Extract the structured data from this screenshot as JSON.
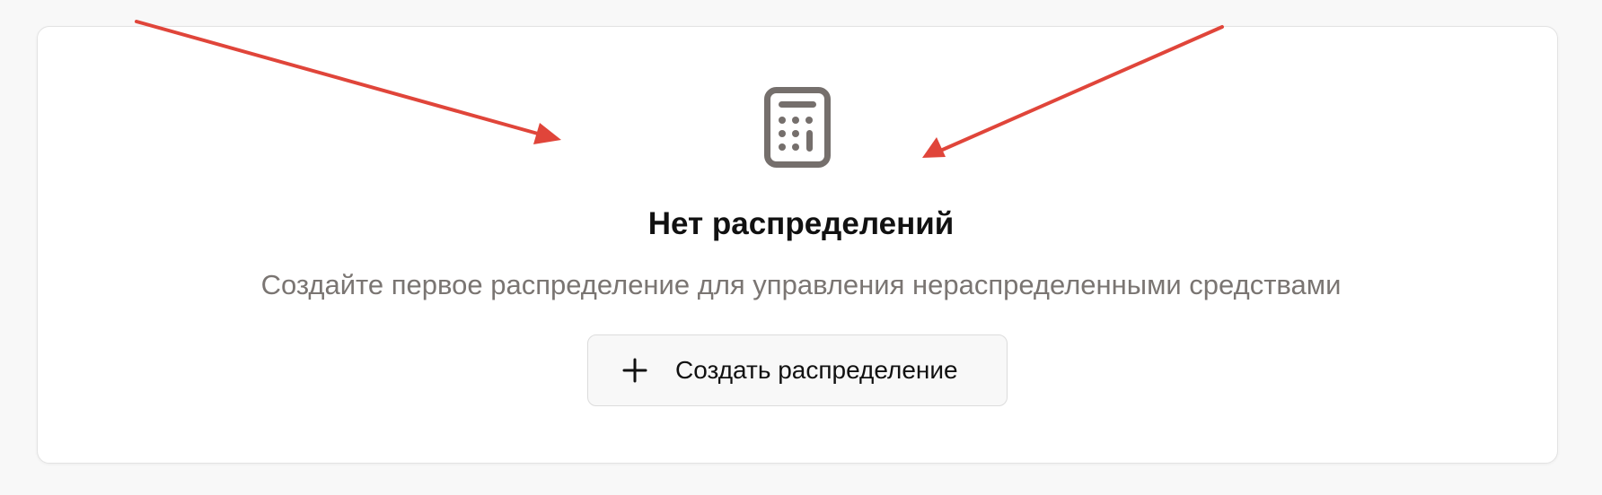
{
  "empty_state": {
    "icon": "calculator-icon",
    "title": "Нет распределений",
    "description": "Создайте первое распределение для управления нераспределенными средствами"
  },
  "create_button": {
    "icon": "plus-icon",
    "label": "Создать распределение"
  },
  "colors": {
    "icon": "#756f6c",
    "title": "#111111",
    "description": "#7a7572",
    "annotation_arrow": "#e0453a",
    "button_background": "#f8f8f8",
    "card_background": "#ffffff",
    "page_background": "#f8f8f8"
  }
}
